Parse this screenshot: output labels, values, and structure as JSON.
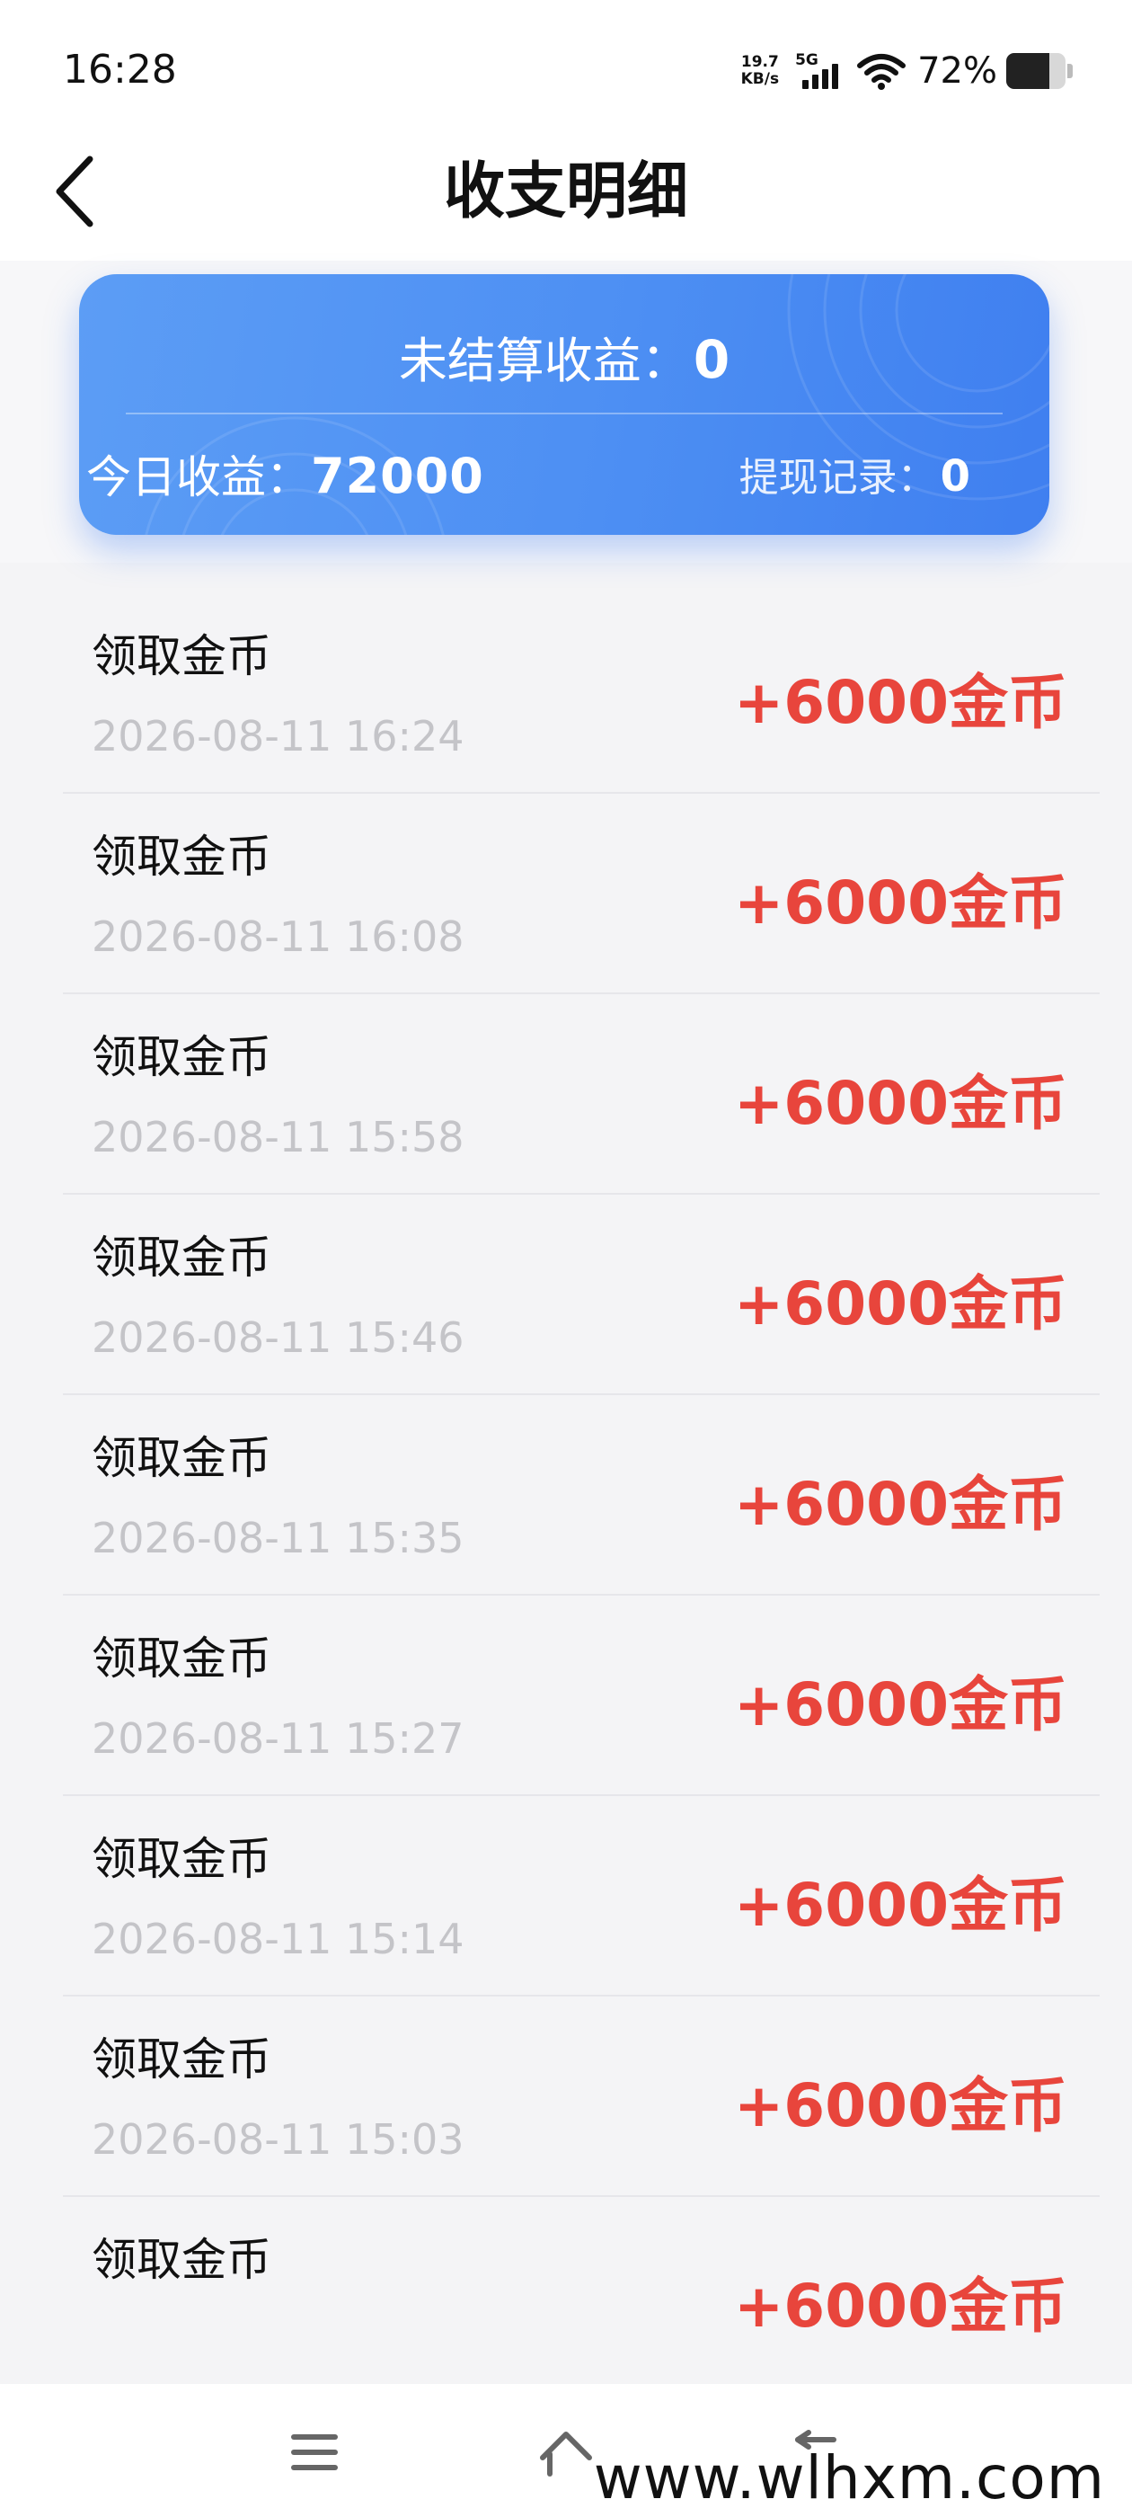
{
  "status_bar": {
    "time": "16:28",
    "net_speed_value": "19.7",
    "net_speed_unit": "KB/s",
    "network": "5G",
    "battery_percent": "72%",
    "battery_level": 0.72
  },
  "header": {
    "title": "收支明细",
    "back_icon": "chevron-left-icon"
  },
  "summary": {
    "unsettled_label": "未结算收益：",
    "unsettled_value": "0",
    "today_label": "今日收益：",
    "today_value": "72000",
    "withdraw_label": "提现记录：",
    "withdraw_value": "0",
    "card_color": "#4d8ff3"
  },
  "transactions": [
    {
      "title": "领取金币",
      "time": "2026-08-11 16:24",
      "amount": "+6000金币"
    },
    {
      "title": "领取金币",
      "time": "2026-08-11 16:08",
      "amount": "+6000金币"
    },
    {
      "title": "领取金币",
      "time": "2026-08-11 15:58",
      "amount": "+6000金币"
    },
    {
      "title": "领取金币",
      "time": "2026-08-11 15:46",
      "amount": "+6000金币"
    },
    {
      "title": "领取金币",
      "time": "2026-08-11 15:35",
      "amount": "+6000金币"
    },
    {
      "title": "领取金币",
      "time": "2026-08-11 15:27",
      "amount": "+6000金币"
    },
    {
      "title": "领取金币",
      "time": "2026-08-11 15:14",
      "amount": "+6000金币"
    },
    {
      "title": "领取金币",
      "time": "2026-08-11 15:03",
      "amount": "+6000金币"
    },
    {
      "title": "领取金币",
      "time": "",
      "amount": "+6000金币"
    }
  ],
  "amount_color": "#e8453c",
  "bottom_nav": {
    "icons": [
      "menu-icon",
      "home-icon",
      "back-arrow-icon"
    ]
  },
  "watermark": "www.wlhxm.com"
}
